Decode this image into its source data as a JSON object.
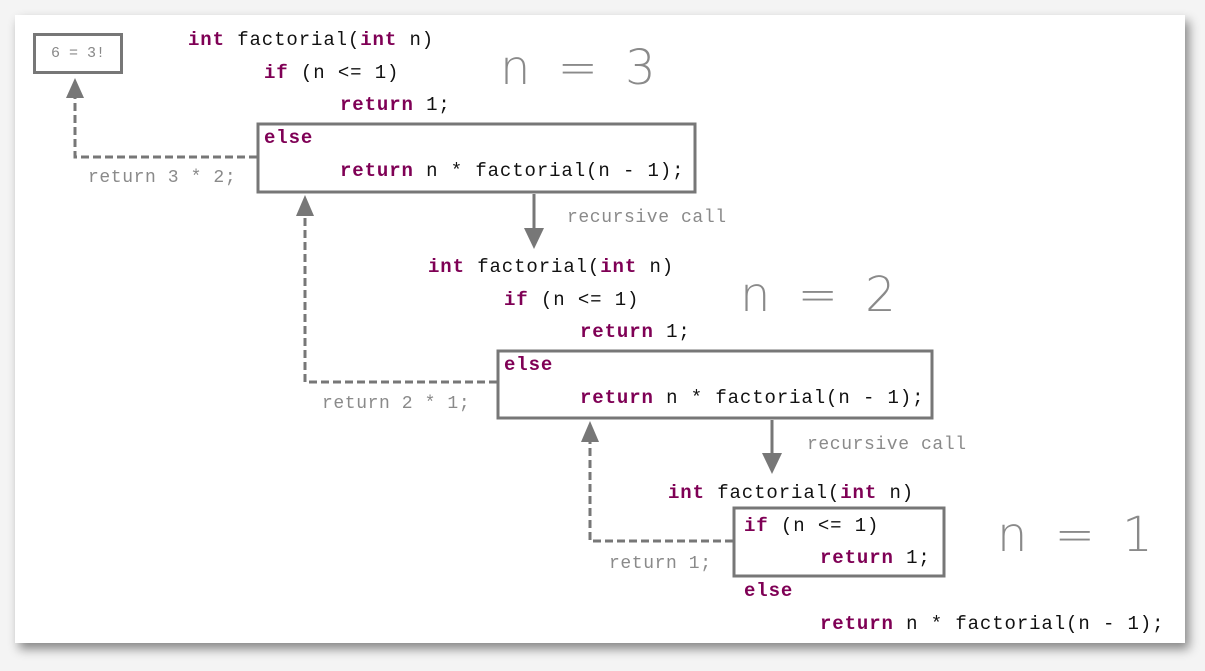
{
  "result": "6 = 3!",
  "colors": {
    "keyword": "#7f0055",
    "annotation": "#8a8a8a",
    "box": "#777777"
  },
  "frames": [
    {
      "n_label": "n = 3",
      "header": {
        "kw1": "int",
        "t1": " factorial(",
        "kw2": "int",
        "t2": " n)"
      },
      "if": {
        "kw": "if",
        "t": " (n <= 1)"
      },
      "ret1": {
        "kw": "return",
        "t": " 1;"
      },
      "else": "else",
      "ret2": {
        "kw": "return",
        "t": " n * factorial(n - 1);"
      },
      "return_note": "return 3 * 2;",
      "call_note": "recursive call"
    },
    {
      "n_label": "n = 2",
      "header": {
        "kw1": "int",
        "t1": " factorial(",
        "kw2": "int",
        "t2": " n)"
      },
      "if": {
        "kw": "if",
        "t": " (n <= 1)"
      },
      "ret1": {
        "kw": "return",
        "t": " 1;"
      },
      "else": "else",
      "ret2": {
        "kw": "return",
        "t": " n * factorial(n - 1);"
      },
      "return_note": "return 2 * 1;",
      "call_note": "recursive call"
    },
    {
      "n_label": "n = 1",
      "header": {
        "kw1": "int",
        "t1": " factorial(",
        "kw2": "int",
        "t2": " n)"
      },
      "if": {
        "kw": "if",
        "t": " (n <= 1)"
      },
      "ret1": {
        "kw": "return",
        "t": " 1;"
      },
      "else": "else",
      "ret2": {
        "kw": "return",
        "t": " n * factorial(n - 1);"
      },
      "return_note": "return 1;"
    }
  ]
}
